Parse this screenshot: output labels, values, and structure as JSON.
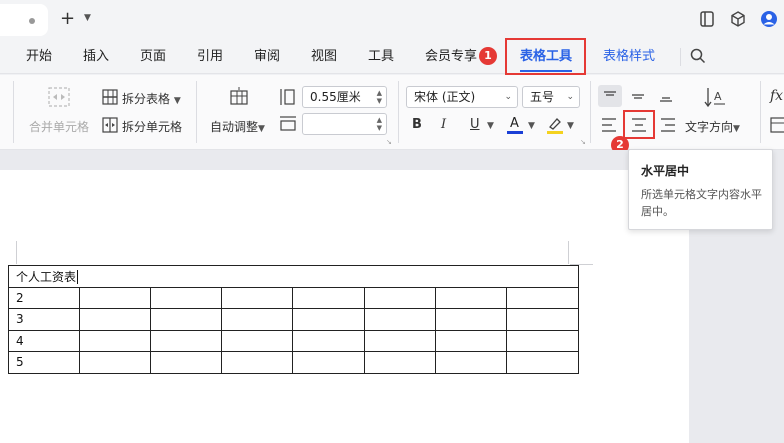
{
  "titlebar": {
    "new_tab_symbol": "+",
    "icons": [
      "tablet-icon",
      "cube-icon",
      "account-icon"
    ]
  },
  "ribbon_tabs": [
    {
      "label": "开始"
    },
    {
      "label": "插入"
    },
    {
      "label": "页面"
    },
    {
      "label": "引用"
    },
    {
      "label": "审阅"
    },
    {
      "label": "视图"
    },
    {
      "label": "工具"
    },
    {
      "label": "会员专享"
    },
    {
      "label": "表格工具",
      "active": true
    },
    {
      "label": "表格样式"
    }
  ],
  "badges": {
    "step1": "1",
    "step2": "2"
  },
  "toolbar": {
    "merge_cells": "合并单元格",
    "split_table": "拆分表格",
    "split_cells": "拆分单元格",
    "auto_fit": "自动调整",
    "row_height_value": "0.55厘米",
    "col_width_value": "",
    "font_name": "宋体 (正文)",
    "font_size": "五号",
    "bold": "B",
    "italic": "I",
    "underline": "U",
    "font_color_letter": "A",
    "text_direction": "文字方向",
    "formula_label": "fx"
  },
  "colors": {
    "accent": "#2a62e6",
    "highlight_red": "#e53935",
    "font_color_bar": "#1a3fd6",
    "highlight_bar": "#f4d21f"
  },
  "tooltip": {
    "title": "水平居中",
    "description": "所选单元格文字内容水平居中。"
  },
  "document": {
    "table_title": "个人工资表",
    "rows": [
      "2",
      "3",
      "4",
      "5"
    ]
  }
}
